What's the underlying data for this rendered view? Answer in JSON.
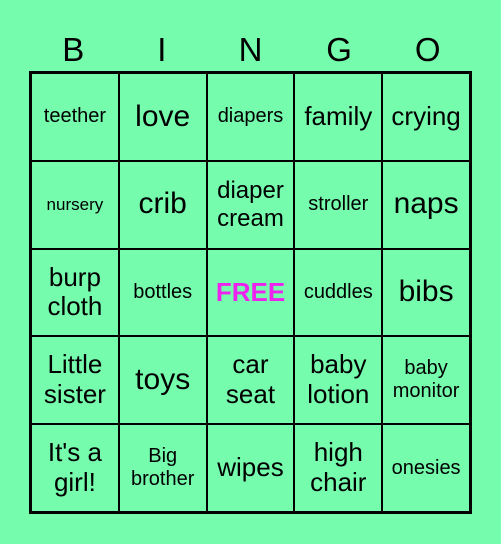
{
  "header": [
    "B",
    "I",
    "N",
    "G",
    "O"
  ],
  "cells": [
    [
      "teether",
      "love",
      "diapers",
      "family",
      "crying"
    ],
    [
      "nursery",
      "crib",
      "diaper cream",
      "stroller",
      "naps"
    ],
    [
      "burp cloth",
      "bottles",
      "FREE",
      "cuddles",
      "bibs"
    ],
    [
      "Little sister",
      "toys",
      "car seat",
      "baby lotion",
      "baby monitor"
    ],
    [
      "It's a girl!",
      "Big brother",
      "wipes",
      "high chair",
      "onesies"
    ]
  ],
  "free_color": "#ee22ee",
  "background_color": "#75fcad"
}
